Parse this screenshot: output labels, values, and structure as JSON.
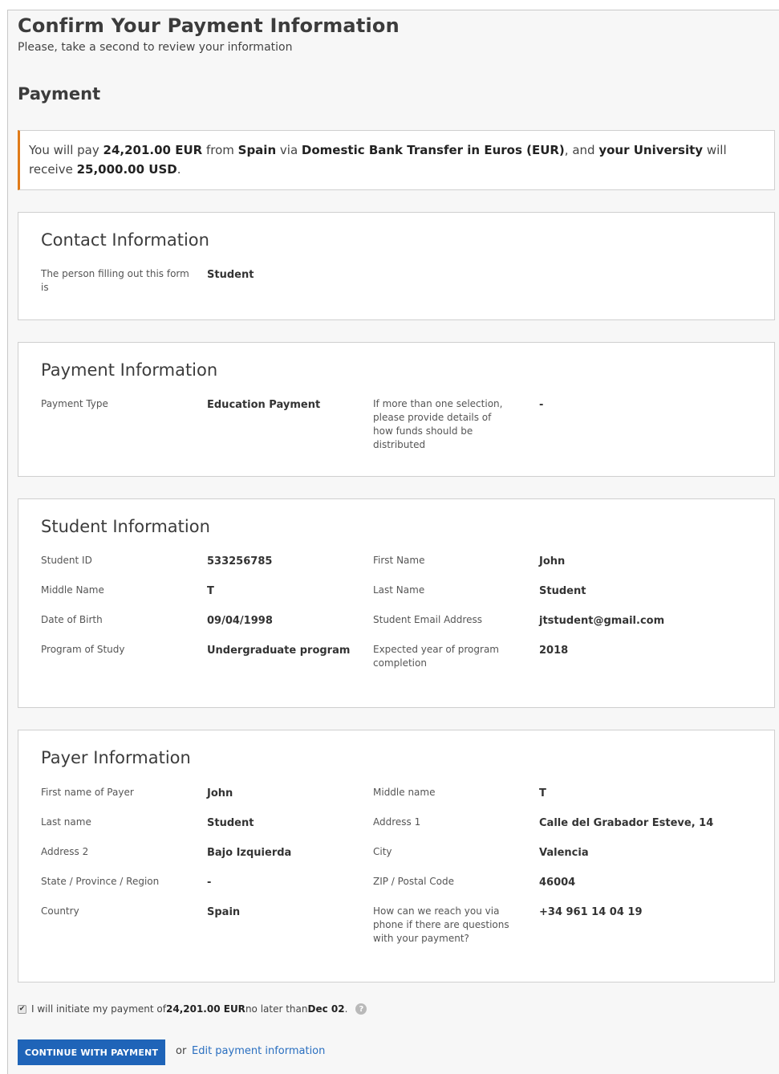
{
  "header": {
    "title": "Confirm Your Payment Information",
    "subtitle": "Please, take a second to review your information"
  },
  "payment_section": {
    "title": "Payment"
  },
  "notice": {
    "t1": "You will pay ",
    "amount_paid": "24,201.00 EUR",
    "t2": " from ",
    "country": "Spain",
    "t3": " via ",
    "method": "Domestic Bank Transfer in Euros (EUR)",
    "t4": ", and ",
    "recipient": "your University",
    "t5": " will receive ",
    "amount_received": "25,000.00 USD",
    "t6": "."
  },
  "contact": {
    "title": "Contact Information",
    "filler_label": "The person filling out this form is",
    "filler_value": "Student"
  },
  "payment_info": {
    "title": "Payment Information",
    "type_label": "Payment Type",
    "type_value": "Education Payment",
    "details_label": "If more than one selection, please provide details of how funds should be distributed",
    "details_value": "-"
  },
  "student": {
    "title": "Student Information",
    "id_label": "Student ID",
    "id_value": "533256785",
    "first_label": "First Name",
    "first_value": "John",
    "middle_label": "Middle Name",
    "middle_value": "T",
    "last_label": "Last Name",
    "last_value": "Student",
    "dob_label": "Date of Birth",
    "dob_value": "09/04/1998",
    "email_label": "Student Email Address",
    "email_value": "jtstudent@gmail.com",
    "program_label": "Program of Study",
    "program_value": "Undergraduate program",
    "year_label": "Expected year of program completion",
    "year_value": "2018"
  },
  "payer": {
    "title": "Payer Information",
    "first_label": "First name of Payer",
    "first_value": "John",
    "middle_label": "Middle name",
    "middle_value": "T",
    "last_label": "Last name",
    "last_value": "Student",
    "address1_label": "Address 1",
    "address1_value": "Calle del Grabador Esteve, 14",
    "address2_label": "Address 2",
    "address2_value": "Bajo Izquierda",
    "city_label": "City",
    "city_value": "Valencia",
    "state_label": "State / Province / Region",
    "state_value": "-",
    "zip_label": "ZIP / Postal Code",
    "zip_value": "46004",
    "country_label": "Country",
    "country_value": "Spain",
    "phone_label": "How can we reach you via phone if there are questions with your payment?",
    "phone_value": "+34 961 14 04 19"
  },
  "confirm": {
    "checkmark": "✔",
    "t1": "I will initiate my payment of ",
    "amount": "24,201.00 EUR",
    "t2": " no later than ",
    "date": "Dec 02",
    "t3": ".",
    "help_glyph": "?"
  },
  "actions": {
    "continue_label": "CONTINUE WITH PAYMENT",
    "or_text": "or",
    "edit_label": "Edit payment information"
  },
  "colors": {
    "accent": "#e07b1a",
    "primary": "#1f64b8",
    "link": "#2a6fc0"
  },
  "icons": {
    "checkbox": "checkbox-checked-icon",
    "help": "question-circle-icon"
  }
}
